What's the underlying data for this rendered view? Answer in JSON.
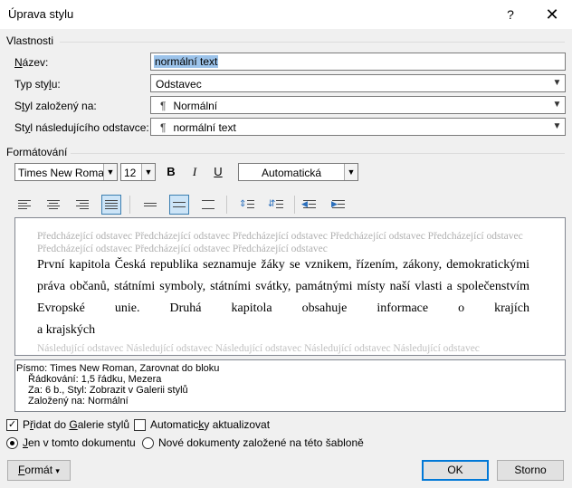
{
  "window": {
    "title": "Úprava stylu",
    "help": "?",
    "close": "✕"
  },
  "properties": {
    "group_label": "Vlastnosti",
    "name_label_key": "N",
    "name_label_rest": "ázev:",
    "name_value": "normální text",
    "type_label_pre": "Typ sty",
    "type_label_key": "l",
    "type_label_post": "u:",
    "type_value": "Odstavec",
    "based_label_pre": "S",
    "based_label_key": "t",
    "based_label_post": "yl založený na:",
    "based_value": "Normální",
    "next_label_pre": "St",
    "next_label_key": "y",
    "next_label_post": "l následujícího odstavce:",
    "next_value": "normální text",
    "paragraph_glyph": "¶"
  },
  "formatting": {
    "group_label": "Formátování",
    "font": "Times New Roman",
    "size": "12",
    "bold": "B",
    "italic": "I",
    "underline": "U",
    "color": "Automatická"
  },
  "preview": {
    "prev_line1": "Předcházející odstavec Předcházející odstavec Předcházející odstavec Předcházející odstavec Předcházející odstavec",
    "prev_line2": "Předcházející odstavec Předcházející odstavec Předcházející odstavec",
    "main_line1": "První kapitola Česká republika seznamuje žáky se vznikem, řízením, zákony, demokratickými",
    "main_line2": "práva občanů, státními symboly, státními svátky, památnými místy naší vlasti a společenstvím",
    "main_line3": "Evropské unie. Druhá kapitola obsahuje informace o krajích",
    "main_line4": "a krajských",
    "next_line": "Následující odstavec Následující odstavec Následující odstavec Následující odstavec Následující odstavec"
  },
  "description": {
    "line1": "Písmo: Times New Roman, Zarovnat do bloku",
    "line2": "Řádkování:  1,5 řádku, Mezera",
    "line3": "Za:  6 b., Styl: Zobrazit v Galerii stylů",
    "line4": "Založený na: Normální"
  },
  "options": {
    "add_gallery_pre": "P",
    "add_gallery_key": "ř",
    "add_gallery_mid": "idat do ",
    "add_gallery_key2": "G",
    "add_gallery_post": "alerie stylů",
    "add_gallery_checked": true,
    "auto_update_pre": "Automatic",
    "auto_update_key": "k",
    "auto_update_post": "y aktualizovat",
    "auto_update_checked": false,
    "only_doc_key": "J",
    "only_doc_rest": "en v tomto dokumentu",
    "new_docs": "Nové dokumenty založené na této šabloně"
  },
  "buttons": {
    "format_key": "F",
    "format_rest": "ormát",
    "format_arrow": "▾",
    "ok": "OK",
    "cancel": "Storno"
  }
}
